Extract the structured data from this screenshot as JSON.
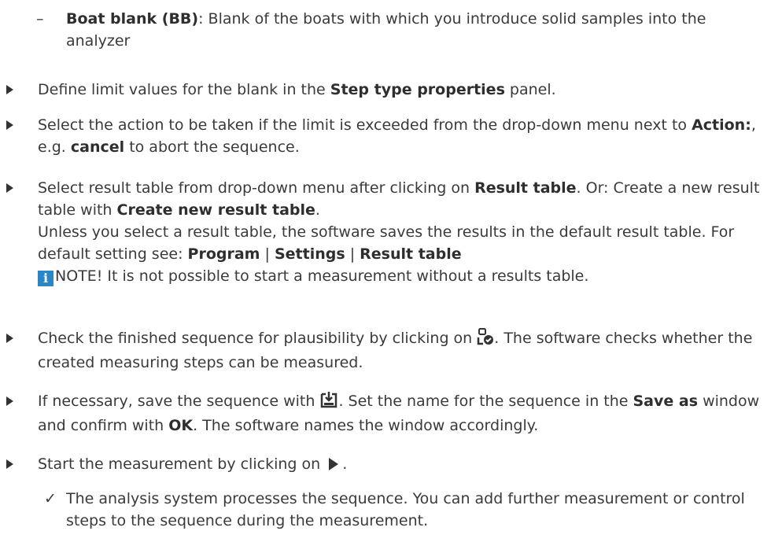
{
  "doc": {
    "bb": {
      "label": "Boat blank (BB)",
      "text": ": Blank of the boats with which you introduce solid samples into the analyzer"
    },
    "s1": {
      "a": "Define limit values for the blank in the ",
      "b": "Step type properties",
      "c": " panel."
    },
    "s2": {
      "a": "Select the action to be taken if the limit is exceeded from the drop-down menu next to ",
      "b": "Action:",
      "c": ", e.g. ",
      "d": "cancel",
      "e": " to abort the sequence."
    },
    "s3": {
      "a": "Select result table from drop-down menu after clicking on ",
      "b": "Result table",
      "c": ". Or: Create a new result table with ",
      "d": "Create new result table",
      "e": ".",
      "f": "Unless you select a result table, the software saves the results in the default result table. For default setting see: ",
      "path1": "Program",
      "sep": " | ",
      "path2": "Settings",
      "path3": "Result table",
      "note": "NOTE! It is not possible to start a measurement without a results table.",
      "note_icon": "info-icon"
    },
    "s4": {
      "a": "Check the finished sequence for plausibility by clicking on ",
      "icon": "check-sequence-icon",
      "b": ". The software checks whether the created measuring steps can be measured."
    },
    "s5": {
      "a": "If necessary, save the sequence with ",
      "icon": "save-icon",
      "b": ". Set the name for the sequence in the ",
      "c": "Save as",
      "d": " window and confirm with ",
      "e": "OK",
      "f": ". The software names the window accordingly."
    },
    "s6": {
      "a": "Start the measurement by clicking on ",
      "icon": "play-icon",
      "b": "."
    },
    "result": "The analysis system processes the sequence. You can add further measurement or control steps to the sequence during the measurement."
  }
}
